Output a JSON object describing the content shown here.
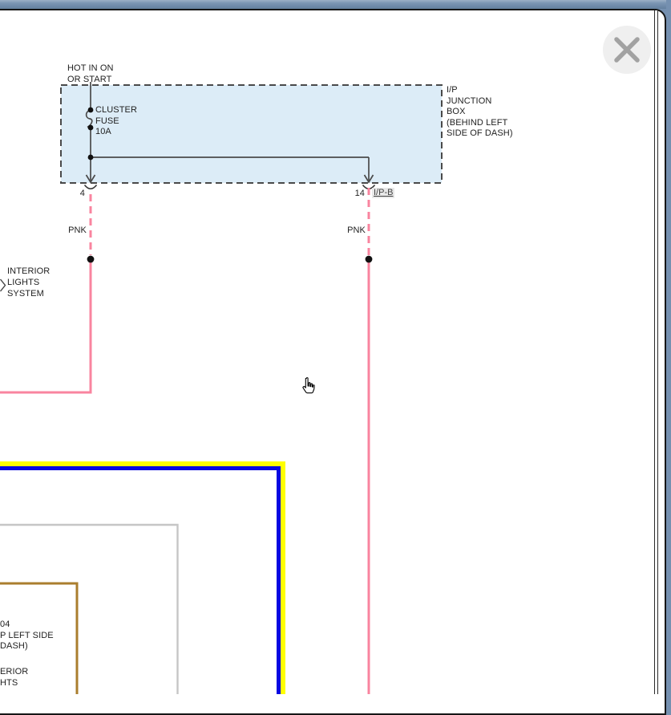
{
  "colors": {
    "titlebar": "#7590b0",
    "wire_pink": "#f9849f",
    "fuse_box_fill": "#dcecf7",
    "wire_dark": "#4a4a4a",
    "line_yellow": "#ffff00",
    "line_blue": "#0a0ae0",
    "line_gray": "#c6c6c6",
    "line_brown": "#aa7e2e"
  },
  "diagram": {
    "hot_label": [
      "HOT IN ON",
      "OR START"
    ],
    "fuse_label": [
      "CLUSTER",
      "FUSE",
      "10A"
    ],
    "junction_box_label": [
      "I/P",
      "JUNCTION",
      "BOX",
      "(BEHIND LEFT",
      "SIDE OF DASH)"
    ],
    "pin_left": "4",
    "pin_right": "14",
    "connector_right": "I/P-B",
    "wire_label_left": "PNK",
    "wire_label_right": "PNK",
    "offpage_label": [
      "INTERIOR",
      "LIGHTS",
      "SYSTEM"
    ],
    "cutoff_ground_label": [
      "04",
      "P LEFT SIDE",
      "DASH)"
    ],
    "cutoff_system_label": [
      "ERIOR",
      "HTS"
    ]
  }
}
